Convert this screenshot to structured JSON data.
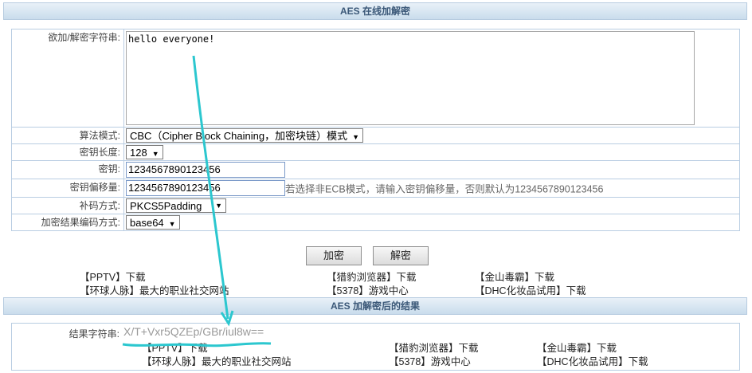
{
  "header": {
    "title": "AES 在线加解密"
  },
  "form": {
    "input_label": "欲加/解密字符串:",
    "input_value": "hello everyone!",
    "mode_label": "算法模式:",
    "mode_value": "CBC（Cipher Block Chaining，加密块链）模式",
    "keylen_label": "密钥长度:",
    "keylen_value": "128",
    "key_label": "密钥:",
    "key_value": "1234567890123456",
    "iv_label": "密钥偏移量:",
    "iv_value": "1234567890123456",
    "iv_hint": "若选择非ECB模式，请输入密钥偏移量，否则默认为1234567890123456",
    "padding_label": "补码方式:",
    "padding_value": "PKCS5Padding",
    "encoding_label": "加密结果编码方式:",
    "encoding_value": "base64"
  },
  "buttons": {
    "encrypt": "加密",
    "decrypt": "解密"
  },
  "ads1": {
    "pptv": "【PPTV】下载",
    "liebao": "【猎豹浏览器】下载",
    "jinshan": "【金山毒霸】下载",
    "huanqiu": "【环球人脉】最大的职业社交网站",
    "g5378": "【5378】游戏中心",
    "dhc": "【DHC化妆品试用】下载"
  },
  "result_header": {
    "title": "AES 加解密后的结果"
  },
  "result": {
    "label": "结果字符串:",
    "value": "X/T+Vxr5QZEp/GBr/iul8w=="
  },
  "ads2": {
    "pptv": "【PPTV】下载",
    "liebao": "【猎豹浏览器】下载",
    "jinshan": "【金山毒霸】下载",
    "huanqiu": "【环球人脉】最大的职业社交网站",
    "g5378": "【5378】游戏中心",
    "dhc": "【DHC化妆品试用】下载"
  },
  "colors": {
    "annotation": "#2cc7cf",
    "header_text": "#3b5878"
  }
}
